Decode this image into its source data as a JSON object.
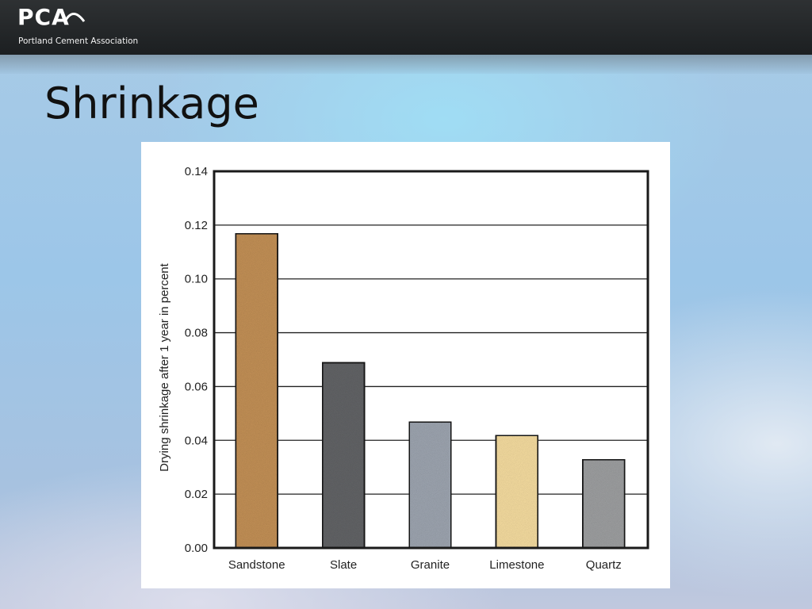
{
  "header": {
    "logo_text": "PCA",
    "logo_subtitle": "Portland Cement Association",
    "background_color": "#25282a"
  },
  "slide": {
    "title": "Shrinkage"
  },
  "chart_data": {
    "type": "bar",
    "title": "",
    "xlabel": "",
    "ylabel": "Drying shrinkage after 1 year in percent",
    "categories": [
      "Sandstone",
      "Slate",
      "Granite",
      "Limestone",
      "Quartz"
    ],
    "values": [
      0.117,
      0.069,
      0.047,
      0.042,
      0.033
    ],
    "ylim": [
      0,
      0.14
    ],
    "yticks": [
      "0.00",
      "0.02",
      "0.04",
      "0.06",
      "0.08",
      "0.10",
      "0.12",
      "0.14"
    ],
    "grid": "horizontal",
    "bar_colors": [
      "#c9955a",
      "#66676b",
      "#a3aab6",
      "#fde3a5",
      "#a3a4a6"
    ]
  }
}
